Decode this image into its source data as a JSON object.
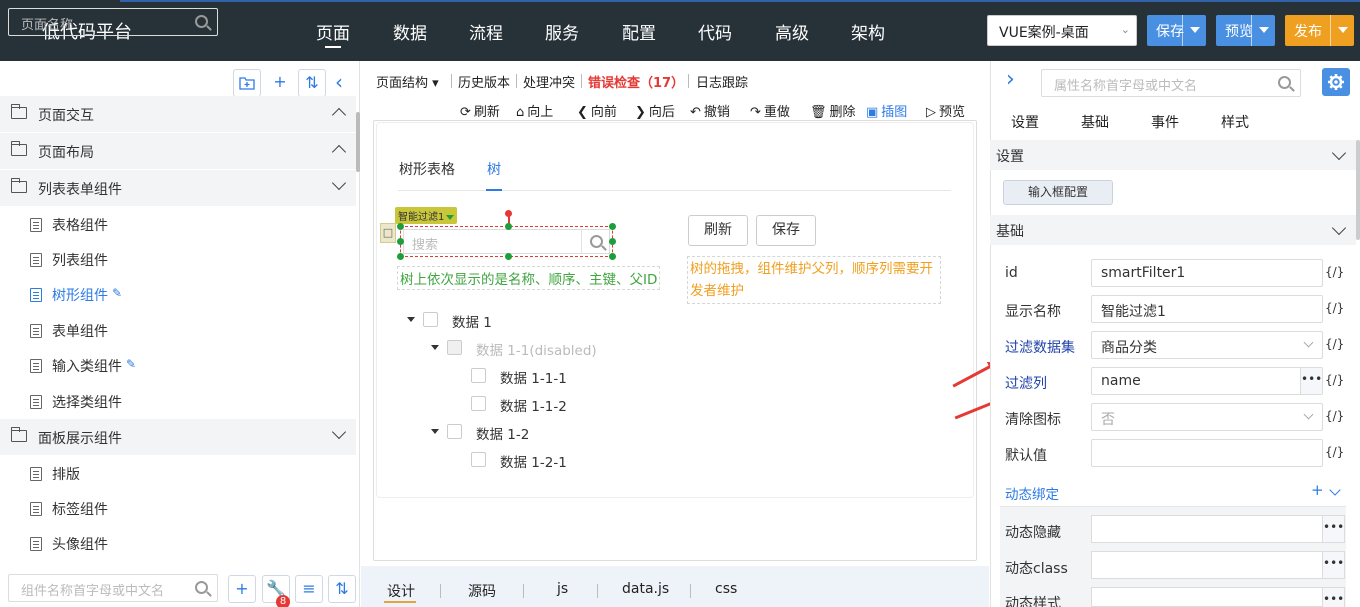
{
  "topbar": {
    "brand": "低代码平台",
    "nav": [
      "页面",
      "数据",
      "流程",
      "服务",
      "配置",
      "代码",
      "高级",
      "架构"
    ],
    "project_select": "VUE案例-桌面",
    "save": "保存",
    "preview": "预览",
    "publish": "发布",
    "colors": {
      "bg": "#263238",
      "save": "#4a90e2",
      "preview": "#4a90e2",
      "publish": "#f0a020"
    }
  },
  "left": {
    "search_placeholder": "页面名称",
    "groups": [
      {
        "label": "页面交互"
      },
      {
        "label": "页面布局"
      },
      {
        "label": "列表表单组件"
      },
      {
        "label": "面板展示组件"
      }
    ],
    "items": [
      "表格组件",
      "列表组件",
      "树形组件",
      "表单组件",
      "输入类组件",
      "选择类组件",
      "排版",
      "标签组件",
      "头像组件"
    ],
    "bottom_search_placeholder": "组件名称首字母或中文名",
    "badge": "8"
  },
  "center": {
    "toolbar1": {
      "structure": "页面结构",
      "history": "历史版本",
      "conflict": "处理冲突",
      "error": "错误检查（17）",
      "log": "日志跟踪"
    },
    "toolbar2": [
      "刷新",
      "向上",
      "向前",
      "向后",
      "撤销",
      "重做",
      "删除",
      "插图",
      "预览"
    ],
    "tabs": [
      "树形表格",
      "树"
    ],
    "chip": "智能过滤1",
    "search_placeholder": "搜索",
    "refresh": "刷新",
    "save": "保存",
    "hint_green": "树上依次显示的是名称、顺序、主键、父ID",
    "hint_orange": "树的拖拽，组件维护父列，顺序列需要开发者维护",
    "tree": [
      "数据 1",
      "数据 1-1(disabled)",
      "数据 1-1-1",
      "数据 1-1-2",
      "数据 1-2",
      "数据 1-2-1"
    ],
    "bottom_tabs": [
      "设计",
      "源码",
      "js",
      "data.js",
      "css"
    ]
  },
  "right": {
    "search_placeholder": "属性名称首字母或中文名",
    "tabs": [
      "设置",
      "基础",
      "事件",
      "样式"
    ],
    "sec_settings": "设置",
    "cfg_button": "输入框配置",
    "sec_basic": "基础",
    "props": [
      {
        "label": "id",
        "value": "smartFilter1"
      },
      {
        "label": "显示名称",
        "value": "智能过滤1"
      },
      {
        "label": "过滤数据集",
        "value": "商品分类"
      },
      {
        "label": "过滤列",
        "value": "name"
      },
      {
        "label": "清除图标",
        "value": "否"
      },
      {
        "label": "默认值",
        "value": ""
      }
    ],
    "curly": "{/}",
    "dynamic_bind": "动态绑定",
    "dyn_props": [
      "动态隐藏",
      "动态class",
      "动态样式"
    ]
  }
}
